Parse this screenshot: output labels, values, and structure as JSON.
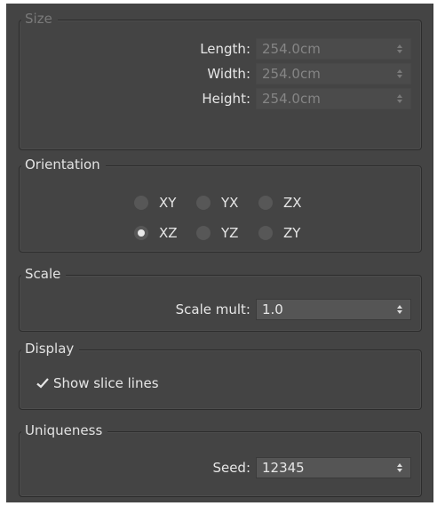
{
  "size": {
    "title": "Size",
    "length_label": "Length:",
    "length_value": "254.0cm",
    "width_label": "Width:",
    "width_value": "254.0cm",
    "height_label": "Height:",
    "height_value": "254.0cm"
  },
  "orientation": {
    "title": "Orientation",
    "options": [
      "XY",
      "YX",
      "ZX",
      "XZ",
      "YZ",
      "ZY"
    ],
    "selected": "XZ"
  },
  "scale": {
    "title": "Scale",
    "mult_label": "Scale mult:",
    "mult_value": "1.0"
  },
  "display": {
    "title": "Display",
    "show_slice_lines_label": "Show slice lines",
    "show_slice_lines_checked": true
  },
  "uniqueness": {
    "title": "Uniqueness",
    "seed_label": "Seed:",
    "seed_value": "12345"
  },
  "colors": {
    "panel_bg": "#444444",
    "text": "#e6e6e6",
    "disabled_text": "#858585",
    "field_bg": "#555555"
  }
}
